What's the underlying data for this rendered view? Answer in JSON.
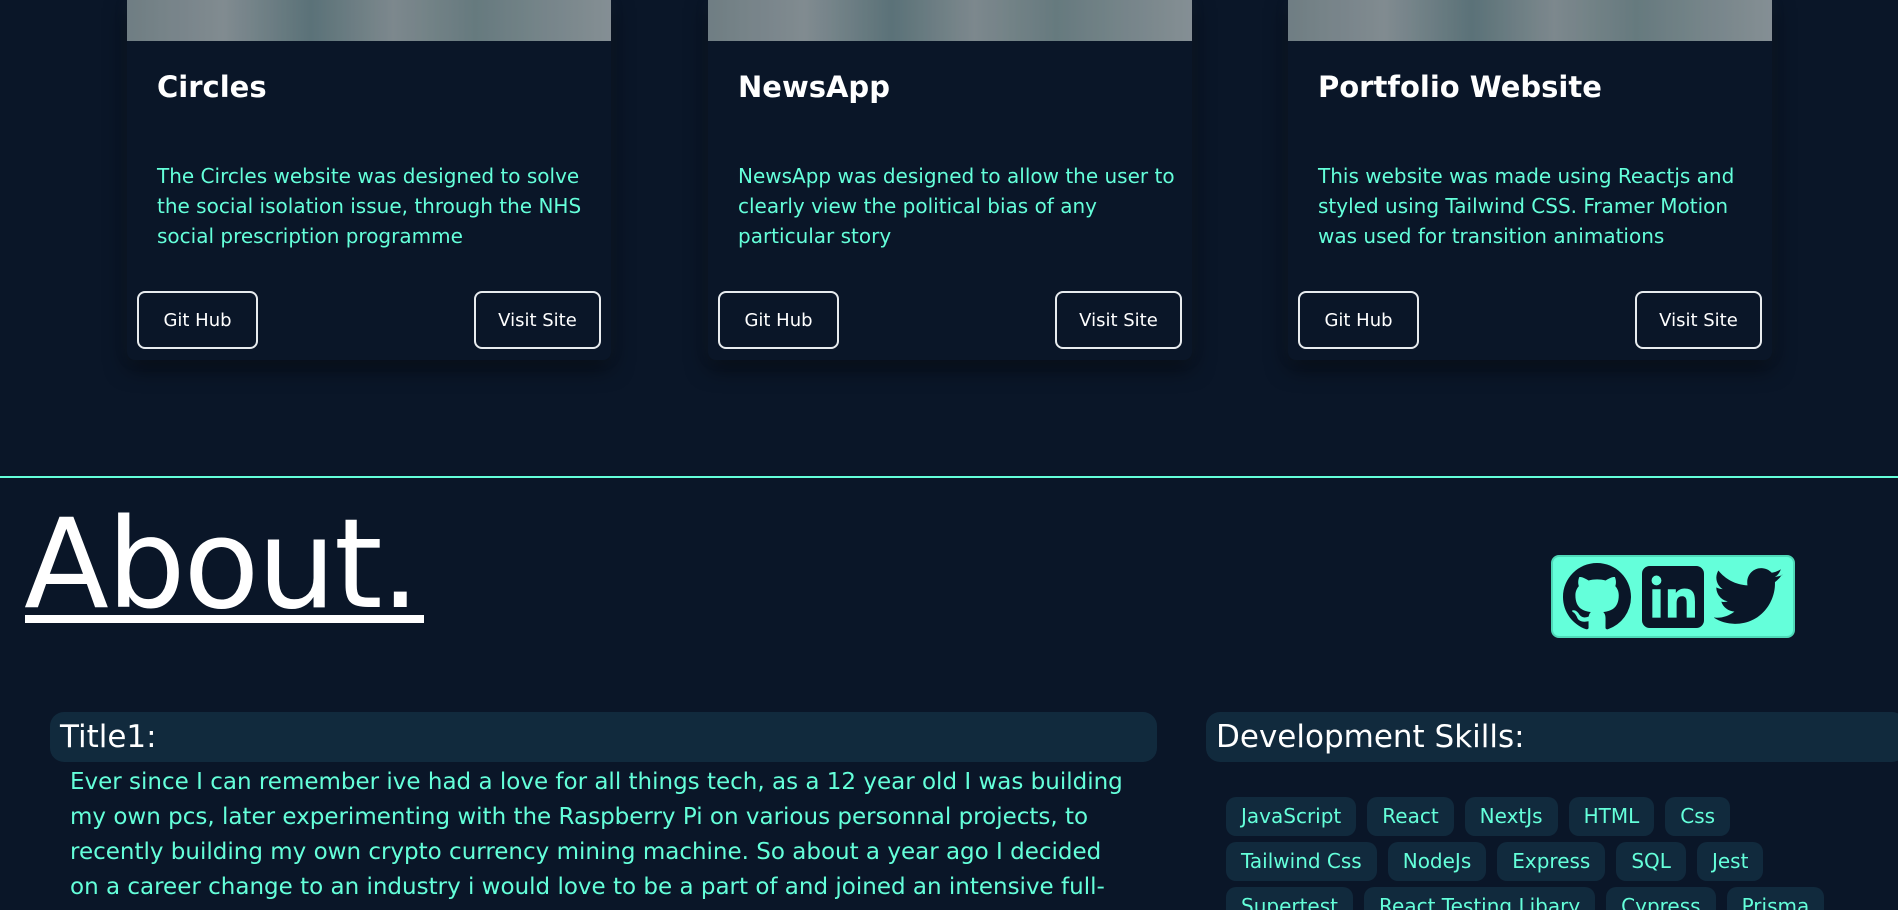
{
  "projects": [
    {
      "title": "Circles",
      "description": "The Circles website was designed to solve the social isolation issue, through the NHS social prescription programme",
      "github_label": "Git Hub",
      "visit_label": "Visit Site"
    },
    {
      "title": "NewsApp",
      "description": "NewsApp was designed to allow the user to clearly view the political bias of any particular story",
      "github_label": "Git Hub",
      "visit_label": "Visit Site"
    },
    {
      "title": "Portfolio Website",
      "description": "This website was made using Reactjs and styled using Tailwind CSS. Framer Motion was used for transition animations",
      "github_label": "Git Hub",
      "visit_label": "Visit Site"
    }
  ],
  "about": {
    "title": "About.",
    "social_icons": [
      "github-icon",
      "linkedin-icon",
      "twitter-icon"
    ],
    "bio_title": "Title1:",
    "bio_text": "Ever since I can remember ive had a love for all things tech, as a 12 year old I was building my own pcs, later experimenting with the Raspberry Pi on various personnal projects, to recently building my own crypto currency mining machine. So about a year ago I decided on a career change to an industry i would love to be a part of and joined an intensive full-stack coding",
    "skills_title": "Development Skills:",
    "skills": [
      [
        "JavaScript",
        "React",
        "NextJs",
        "HTML",
        "Css"
      ],
      [
        "Tailwind Css",
        "NodeJs",
        "Express",
        "SQL",
        "Jest"
      ],
      [
        "Supertest",
        "React Testing Libary",
        "Cypress",
        "Prisma"
      ]
    ]
  },
  "colors": {
    "background": "#0a1628",
    "accent": "#64ffda",
    "panel": "#112a3d",
    "text": "#ffffff"
  }
}
